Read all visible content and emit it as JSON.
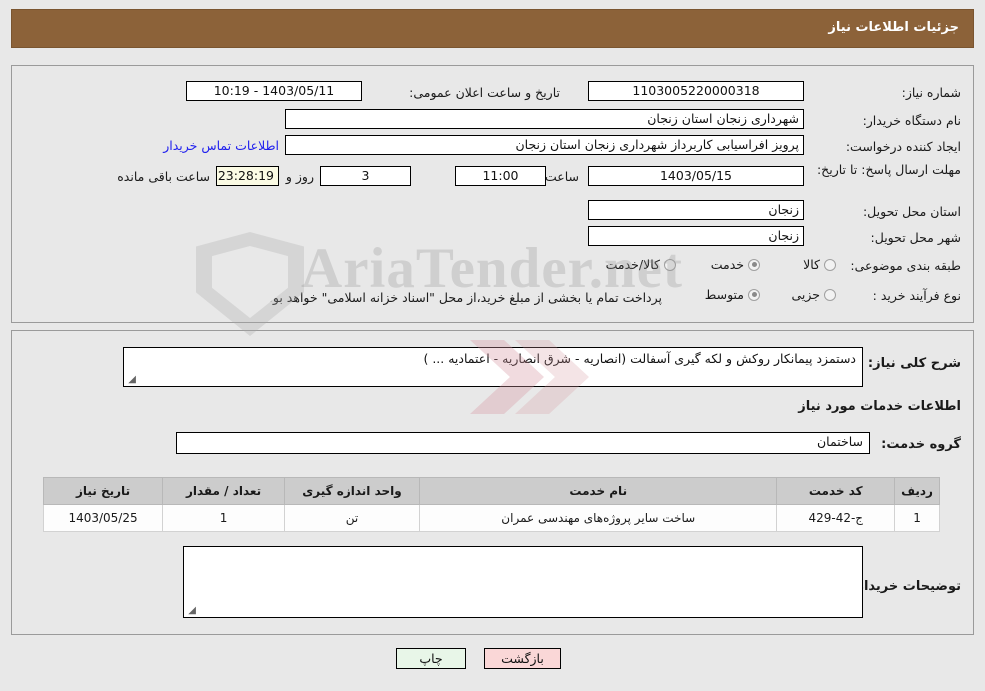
{
  "header": {
    "title": "جزئیات اطلاعات نیاز"
  },
  "form": {
    "need_number_label": "شماره نیاز:",
    "need_number_value": "1103005220000318",
    "announce_datetime_label": "تاریخ و ساعت اعلان عمومی:",
    "announce_datetime_value": "1403/05/11 - 10:19",
    "buyer_org_label": "نام دستگاه خریدار:",
    "buyer_org_value": "شهرداری زنجان استان زنجان",
    "requester_label": "ایجاد کننده درخواست:",
    "requester_value": "پرویز افراسیابی کاربرداز شهرداری زنجان استان زنجان",
    "contact_link": "اطلاعات تماس خریدار",
    "deadline_label": "مهلت ارسال پاسخ: تا تاریخ:",
    "deadline_date": "1403/05/15",
    "hour_label": "ساعت",
    "deadline_time": "11:00",
    "days_remaining": "3",
    "days_label": "روز و",
    "time_remaining": "23:28:19",
    "remaining_suffix": "ساعت باقی مانده",
    "province_label": "استان محل تحویل:",
    "province_value": "زنجان",
    "city_label": "شهر محل تحویل:",
    "city_value": "زنجان",
    "category_label": "طبقه بندی موضوعی:",
    "category_options": [
      {
        "label": "کالا",
        "selected": false
      },
      {
        "label": "خدمت",
        "selected": true
      },
      {
        "label": "کالا/خدمت",
        "selected": false
      }
    ],
    "process_label": "نوع فرآیند خرید :",
    "process_options": [
      {
        "label": "جزیی",
        "selected": false
      },
      {
        "label": "متوسط",
        "selected": true
      }
    ],
    "process_note": "پرداخت تمام یا بخشی از مبلغ خرید،از محل \"اسناد خزانه اسلامی\" خواهد بود."
  },
  "details": {
    "general_desc_label": "شرح کلی نیاز:",
    "general_desc_value": "دستمزد پیمانکار روکش و لکه گیری آسفالت  (انصاریه - شرق انصاریه - اعتمادیه ... )",
    "services_section_title": "اطلاعات خدمات مورد نیاز",
    "service_group_label": "گروه خدمت:",
    "service_group_value": "ساختمان",
    "buyer_notes_label": "توضیحات خریدار:",
    "buyer_notes_value": ""
  },
  "table": {
    "columns": [
      "ردیف",
      "کد خدمت",
      "نام خدمت",
      "واحد اندازه گیری",
      "تعداد / مقدار",
      "تاریخ نیاز"
    ],
    "rows": [
      {
        "row": "1",
        "service_code": "ج-42-429",
        "service_name": "ساخت سایر پروژه‌های مهندسی عمران",
        "unit": "تن",
        "quantity": "1",
        "need_date": "1403/05/25"
      }
    ]
  },
  "footer": {
    "print_label": "چاپ",
    "back_label": "بازگشت"
  },
  "watermark": {
    "text": "AriaTender.net"
  },
  "colors": {
    "header_bg": "#8c6239",
    "link": "#2020ee",
    "table_header_bg": "#cccccc",
    "print_btn_bg": "#e8f6e8",
    "back_btn_bg": "#fad7d7",
    "highlight_field_bg": "#fbfbe4"
  }
}
